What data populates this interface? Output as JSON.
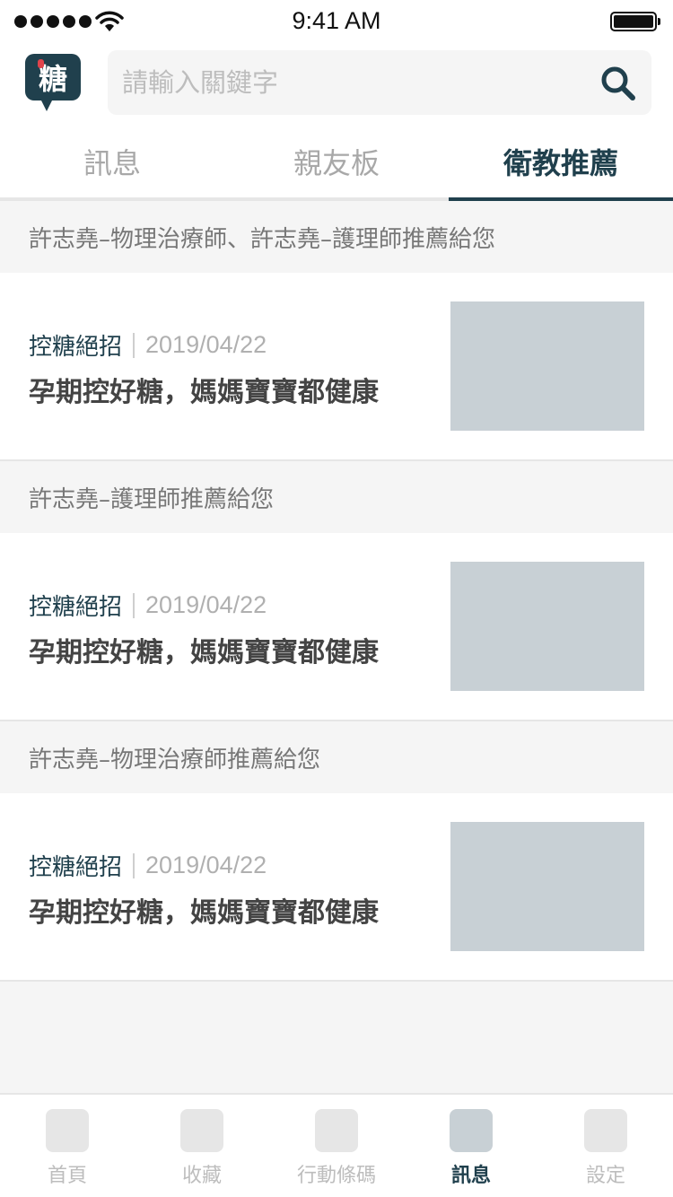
{
  "status_bar": {
    "time": "9:41 AM"
  },
  "header": {
    "logo_char": "糖",
    "search": {
      "placeholder": "請輸入關鍵字"
    }
  },
  "tabs": [
    {
      "label": "訊息",
      "active": false
    },
    {
      "label": "親友板",
      "active": false
    },
    {
      "label": "衛教推薦",
      "active": true
    }
  ],
  "recommendations": [
    {
      "recommender": "許志堯–物理治療師、許志堯–護理師推薦給您",
      "category": "控糖絕招",
      "date": "2019/04/22",
      "title": "孕期控好糖，媽媽寶寶都健康"
    },
    {
      "recommender": "許志堯–護理師推薦給您",
      "category": "控糖絕招",
      "date": "2019/04/22",
      "title": "孕期控好糖，媽媽寶寶都健康"
    },
    {
      "recommender": "許志堯–物理治療師推薦給您",
      "category": "控糖絕招",
      "date": "2019/04/22",
      "title": "孕期控好糖，媽媽寶寶都健康"
    }
  ],
  "tabbar": [
    {
      "label": "首頁",
      "active": false
    },
    {
      "label": "收藏",
      "active": false
    },
    {
      "label": "行動條碼",
      "active": false
    },
    {
      "label": "訊息",
      "active": true
    },
    {
      "label": "設定",
      "active": false
    }
  ],
  "colors": {
    "primary": "#20404d",
    "thumbnail": "#c8d0d5",
    "accent": "#e0434b"
  }
}
